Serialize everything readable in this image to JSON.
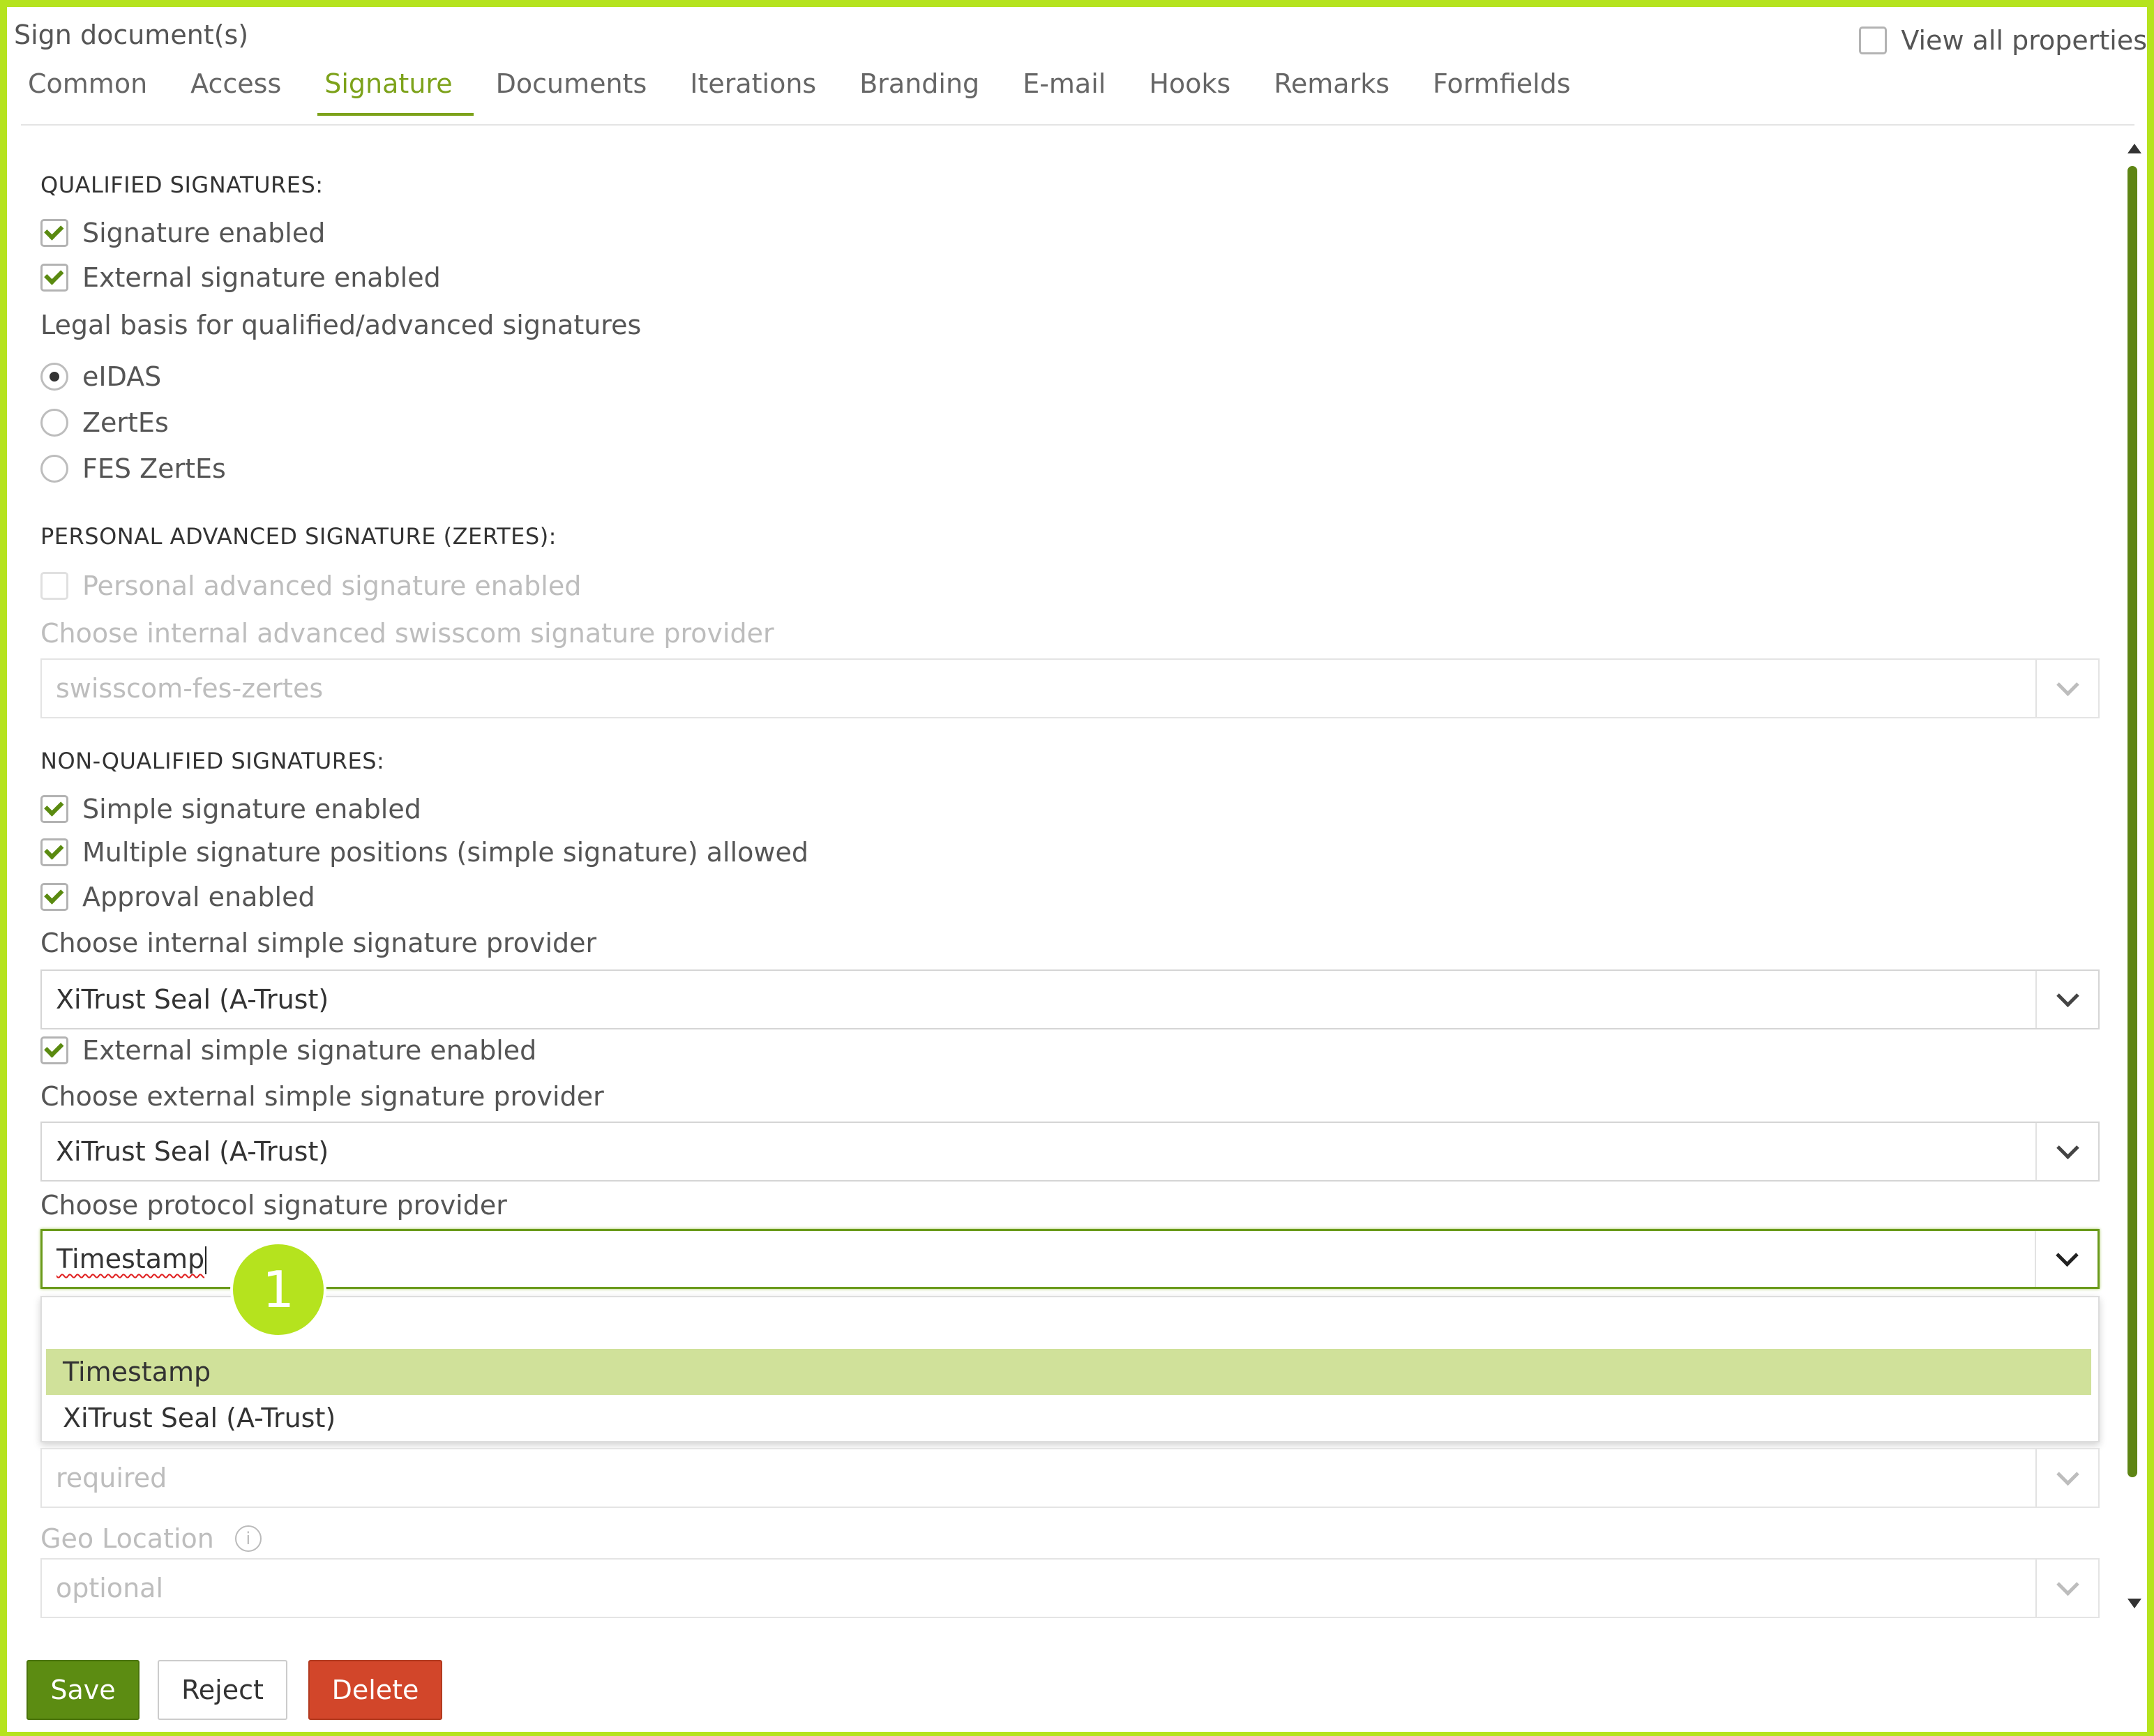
{
  "window": {
    "title": "Sign document(s)",
    "view_all_label": "View all properties",
    "view_all_checked": false
  },
  "tabs": [
    {
      "label": "Common"
    },
    {
      "label": "Access"
    },
    {
      "label": "Signature",
      "active": true
    },
    {
      "label": "Documents"
    },
    {
      "label": "Iterations"
    },
    {
      "label": "Branding"
    },
    {
      "label": "E-mail"
    },
    {
      "label": "Hooks"
    },
    {
      "label": "Remarks"
    },
    {
      "label": "Formfields"
    }
  ],
  "qualified": {
    "heading": "QUALIFIED SIGNATURES:",
    "signature_enabled": {
      "label": "Signature enabled",
      "checked": true
    },
    "external_signature_enabled": {
      "label": "External signature enabled",
      "checked": true
    },
    "legal_basis_label": "Legal basis for qualified/advanced signatures",
    "legal_basis_options": [
      {
        "label": "eIDAS",
        "selected": true
      },
      {
        "label": "ZertEs",
        "selected": false
      },
      {
        "label": "FES ZertEs",
        "selected": false
      }
    ]
  },
  "personal_advanced": {
    "heading": "PERSONAL ADVANCED SIGNATURE (ZERTES):",
    "enabled": {
      "label": "Personal advanced signature enabled",
      "checked": false,
      "disabled": true
    },
    "provider_label": "Choose internal advanced swisscom signature provider",
    "provider_value": "swisscom-fes-zertes"
  },
  "non_qualified": {
    "heading": "NON-QUALIFIED SIGNATURES:",
    "simple_enabled": {
      "label": "Simple signature enabled",
      "checked": true
    },
    "multiple_positions": {
      "label": "Multiple signature positions (simple signature) allowed",
      "checked": true
    },
    "approval_enabled": {
      "label": "Approval enabled",
      "checked": true
    },
    "internal_provider_label": "Choose internal simple signature provider",
    "internal_provider_value": "XiTrust Seal (A-Trust)",
    "external_simple_enabled": {
      "label": "External simple signature enabled",
      "checked": true
    },
    "external_provider_label": "Choose external simple signature provider",
    "external_provider_value": "XiTrust Seal (A-Trust)",
    "protocol_provider_label": "Choose protocol signature provider",
    "protocol_provider_value": "Timestamp",
    "protocol_options": [
      "Timestamp",
      "XiTrust Seal (A-Trust)"
    ],
    "protocol_highlighted": "Timestamp"
  },
  "hidden_field": {
    "value": "required"
  },
  "geo_location": {
    "label": "Geo Location",
    "info_icon": "info-icon",
    "value": "optional"
  },
  "callout": {
    "number": "1"
  },
  "buttons": {
    "save": "Save",
    "reject": "Reject",
    "delete": "Delete"
  },
  "colors": {
    "accent": "#b5e31e",
    "primary": "#5c8c12",
    "danger": "#d2462a",
    "highlight": "#d0e19a",
    "tab_active": "#7da21b"
  }
}
